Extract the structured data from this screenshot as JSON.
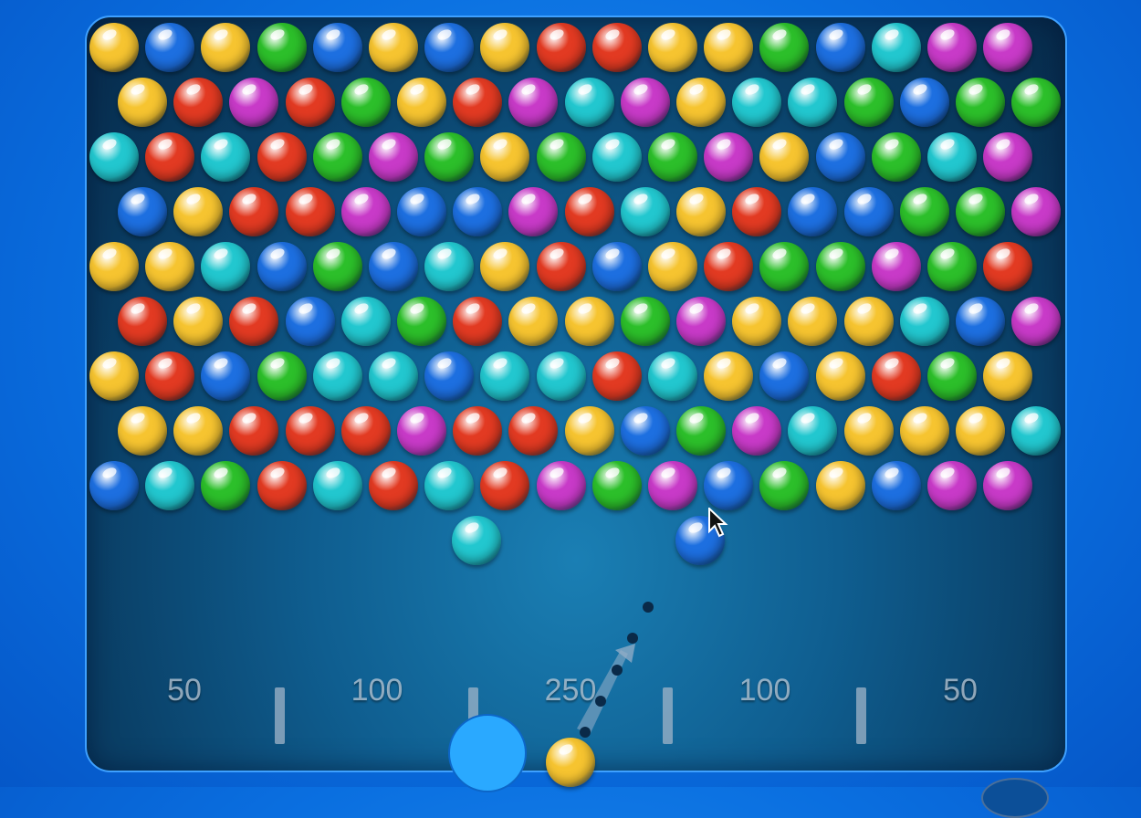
{
  "game": {
    "colors": {
      "Y": "#f6c430",
      "B": "#1d6fe0",
      "R": "#e23a22",
      "G": "#2cbf2a",
      "C": "#22c7cf",
      "M": "#c83ac8"
    },
    "grid_rows": [
      "YBYGBYBYRRYYGBCMM",
      "YRMRGYRMCMYCCGBGG",
      "CRCRGMGYGCGMYBGCM",
      "BYRRMBBMRCYRBBGGM",
      "YYCBGBCYRBYRGGMGR",
      "RYRBCGRYYGMYYYCBM",
      "YRBGCCBCCRCYBYRGY",
      "YYRRRMRRYBGMCYYYC",
      "BCGRCRCRMGMBGYBMM"
    ],
    "floating_bubbles": [
      "C",
      "B"
    ],
    "current_bubble": "Y",
    "score_zones": [
      "50",
      "100",
      "250",
      "100",
      "50"
    ]
  }
}
